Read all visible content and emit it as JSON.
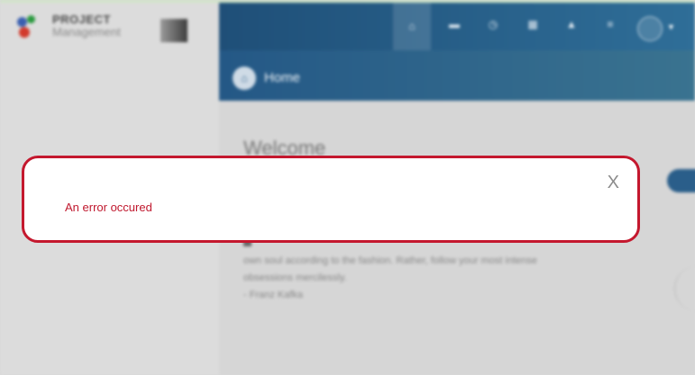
{
  "brand": {
    "line1": "PROJECT",
    "line2": "Management"
  },
  "topbar": {
    "icons": [
      "home-icon",
      "briefcase-icon",
      "clock-icon",
      "calendar-icon",
      "bell-icon",
      "document-icon",
      "user-avatar",
      "chevron-down-icon"
    ],
    "color_start": "#1f4f78",
    "color_end": "#2f6e98"
  },
  "breadcrumb": {
    "label": "Home"
  },
  "main": {
    "heading": "Welcome",
    "quote_lines": [
      "own soul according to the fashion. Rather, follow your most intense",
      "obsessions mercilessly.",
      "- Franz Kafka"
    ]
  },
  "modal": {
    "message": "An error occured",
    "close_label": "X",
    "border_color": "#c4182e"
  }
}
